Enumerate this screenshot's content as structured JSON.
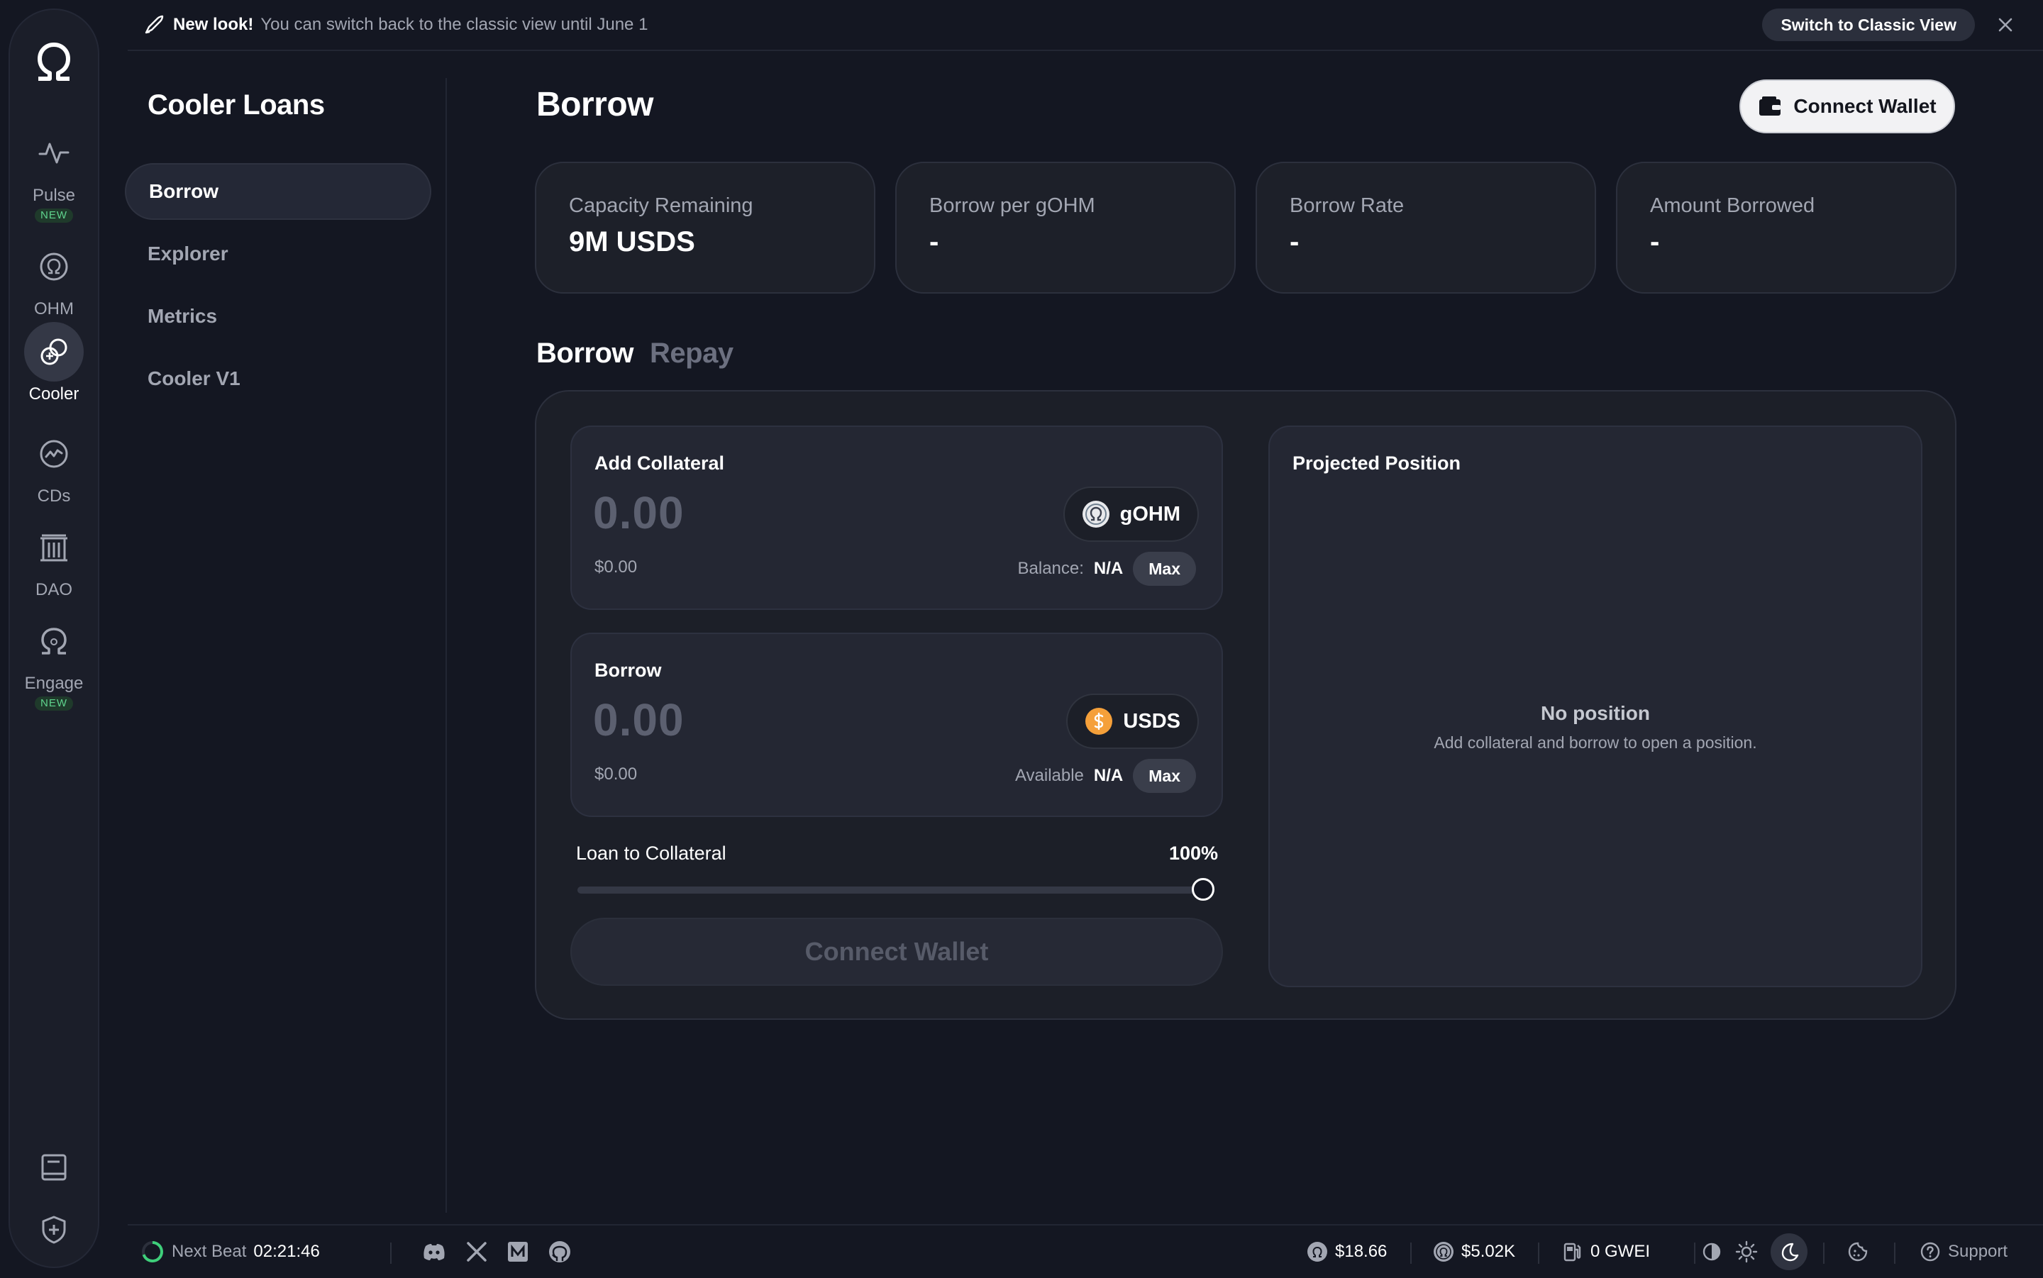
{
  "banner": {
    "strong": "New look!",
    "text": "You can switch back to the classic view until June 1",
    "switch_label": "Switch to Classic View"
  },
  "rail": {
    "items": [
      {
        "label": "Pulse",
        "badge": "NEW",
        "icon": "pulse-icon"
      },
      {
        "label": "OHM",
        "icon": "ohm-icon"
      },
      {
        "label": "Cooler",
        "icon": "cooler-icon",
        "active": true
      },
      {
        "label": "CDs",
        "icon": "cds-icon"
      },
      {
        "label": "DAO",
        "icon": "dao-icon"
      },
      {
        "label": "Engage",
        "badge": "NEW",
        "icon": "engage-icon"
      }
    ],
    "bottom_icons": [
      "docs-icon",
      "shield-plus-icon"
    ]
  },
  "subnav": {
    "title": "Cooler Loans",
    "items": [
      {
        "label": "Borrow",
        "active": true
      },
      {
        "label": "Explorer"
      },
      {
        "label": "Metrics"
      },
      {
        "label": "Cooler V1"
      }
    ]
  },
  "main": {
    "title": "Borrow",
    "connect_wallet": "Connect Wallet",
    "stats": [
      {
        "label": "Capacity Remaining",
        "value": "9M USDS"
      },
      {
        "label": "Borrow per gOHM",
        "value": "-"
      },
      {
        "label": "Borrow Rate",
        "value": "-"
      },
      {
        "label": "Amount Borrowed",
        "value": "-"
      }
    ],
    "tabs": [
      {
        "label": "Borrow",
        "active": true
      },
      {
        "label": "Repay"
      }
    ]
  },
  "form": {
    "collateral": {
      "title": "Add Collateral",
      "amount": "0.00",
      "usd": "$0.00",
      "token": "gOHM",
      "balance_label": "Balance:",
      "balance_value": "N/A",
      "max_label": "Max"
    },
    "borrow": {
      "title": "Borrow",
      "amount": "0.00",
      "usd": "$0.00",
      "token": "USDS",
      "available_label": "Available",
      "available_value": "N/A",
      "max_label": "Max"
    },
    "ltv": {
      "label": "Loan to Collateral",
      "value_text": "100%",
      "value": 1.0
    },
    "submit_label": "Connect Wallet"
  },
  "projected": {
    "title": "Projected Position",
    "empty_title": "No position",
    "empty_sub": "Add collateral and borrow to open a position."
  },
  "footer": {
    "next_beat_label": "Next Beat",
    "next_beat_time": "02:21:46",
    "social_icons": [
      "discord-icon",
      "x-icon",
      "medium-icon",
      "github-icon"
    ],
    "ohm_price": "$18.66",
    "gohm_price": "$5.02K",
    "gas": "0 GWEI",
    "support_label": "Support"
  },
  "colors": {
    "background": "#141722",
    "card": "#242733",
    "accent_new": "#5fd38d",
    "usds": "#f5a03a"
  }
}
